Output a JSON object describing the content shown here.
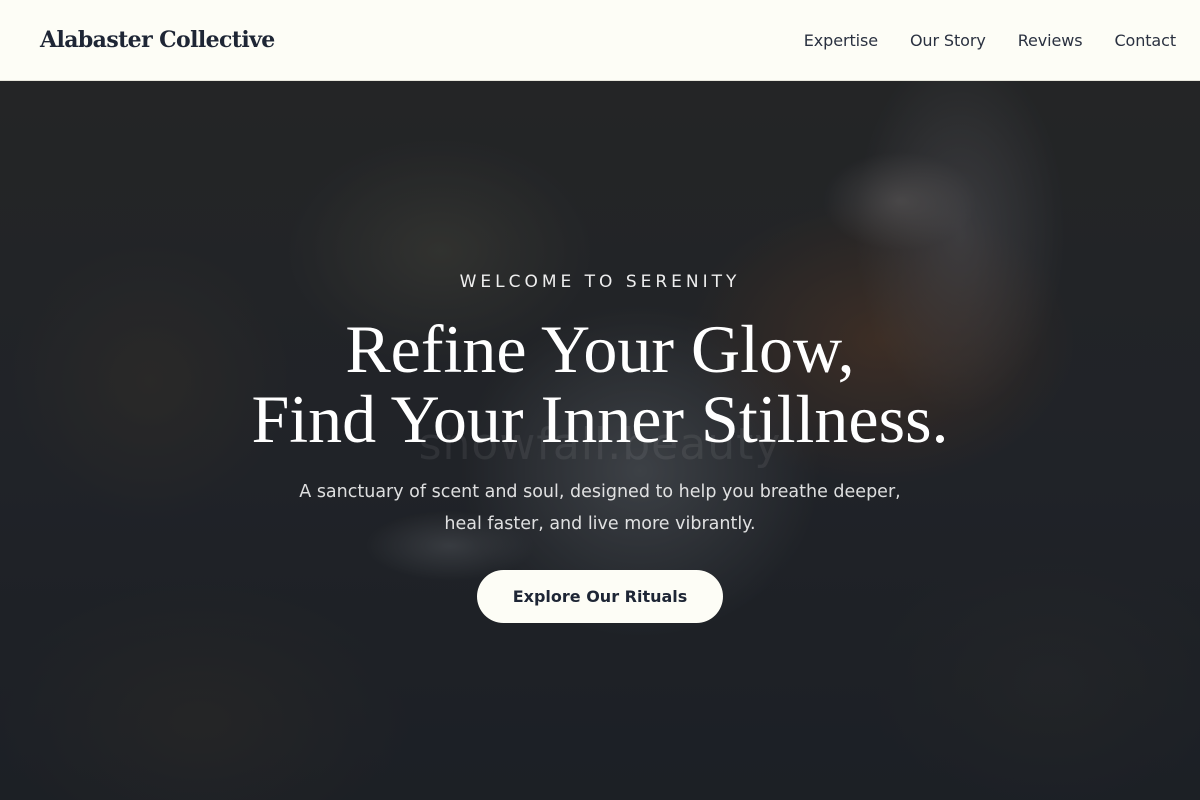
{
  "header": {
    "brand": "Alabaster Collective",
    "nav": [
      {
        "label": "Expertise"
      },
      {
        "label": "Our Story"
      },
      {
        "label": "Reviews"
      },
      {
        "label": "Contact"
      }
    ]
  },
  "hero": {
    "eyebrow": "WELCOME TO SERENITY",
    "headline_line1": "Refine Your Glow,",
    "headline_line2": "Find Your Inner Stillness.",
    "subtext_line1": "A sanctuary of scent and soul, designed to help you breathe deeper,",
    "subtext_line2": "heal faster, and live more vibrantly.",
    "cta_label": "Explore Our Rituals",
    "watermark": "snowfall.beauty"
  },
  "colors": {
    "header_bg": "#fdfdf6",
    "brand_text": "#1e2635",
    "button_bg": "#fdfdf6",
    "hero_text": "#ffffff"
  }
}
